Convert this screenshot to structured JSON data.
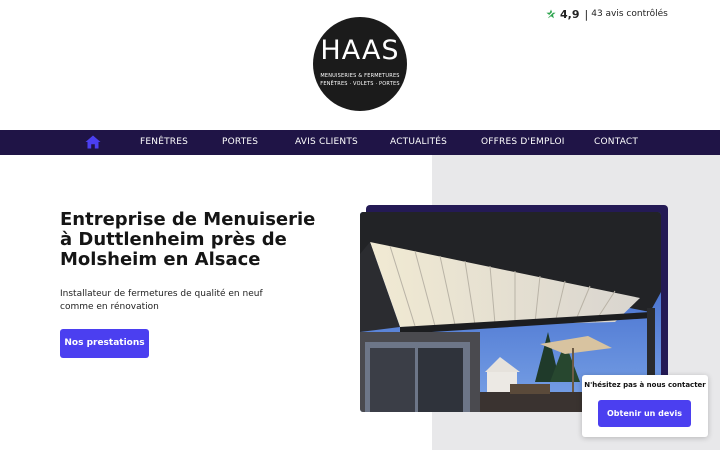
{
  "brand": {
    "logo_word": "HAAS",
    "logo_line1": "MENUISERIES & FERMETURES",
    "logo_line2": "FENÊTRES · VOLETS · PORTES"
  },
  "rating": {
    "icon": "star-icon",
    "score": "4,9",
    "separator": "|",
    "label": "43 avis contrôlés",
    "accent": "#2da44e"
  },
  "nav": {
    "home_icon": "home-icon",
    "items": [
      "FENÊTRES",
      "PORTES",
      "AVIS CLIENTS",
      "ACTUALITÉS",
      "OFFRES D'EMPLOI",
      "CONTACT"
    ],
    "background": "#1f1446",
    "home_color": "#4b3ff0"
  },
  "hero": {
    "title": "Entreprise de Menuiserie à Duttlenheim près de Molsheim en Alsace",
    "subtitle": "Installateur de fermetures de qualité en neuf comme en rénovation",
    "cta_label": "Nos prestations",
    "accent": "#4b3ff0"
  },
  "callout": {
    "text": "N'hésitez pas à nous contacter",
    "button_label": "Obtenir un devis"
  }
}
